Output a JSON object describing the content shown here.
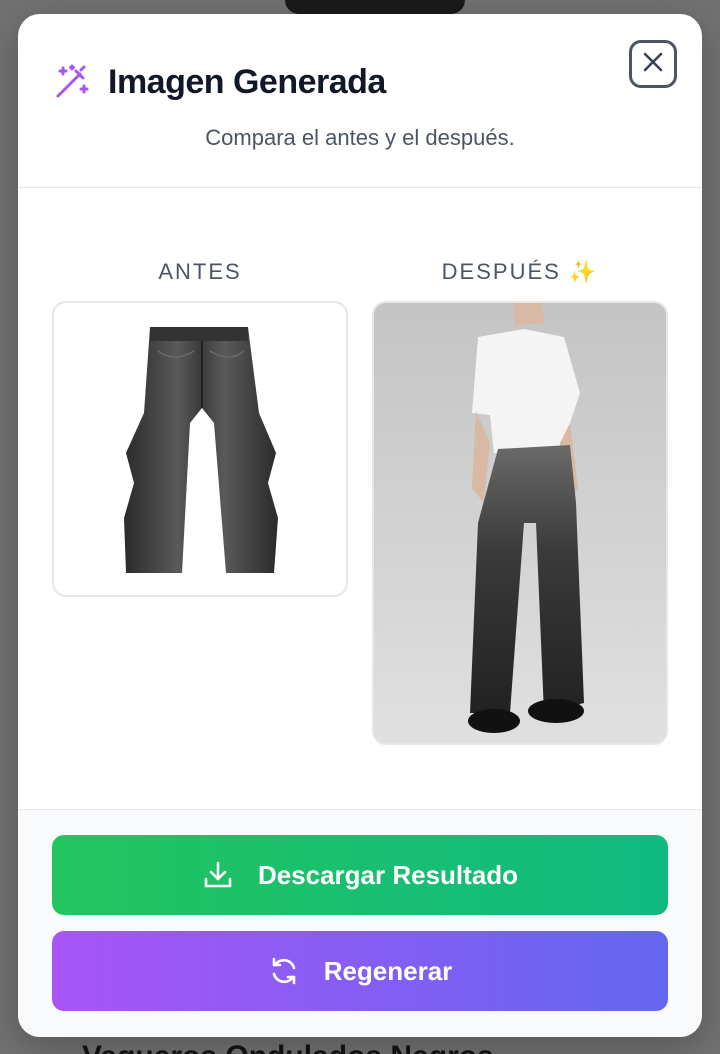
{
  "background": {
    "heading": "Vaqueros Ondulados Negros"
  },
  "modal": {
    "title": "Imagen Generada",
    "subtitle": "Compara el antes y el después.",
    "title_icon": "magic-wand-icon",
    "close_icon": "close-icon"
  },
  "compare": {
    "before_label": "ANTES",
    "after_label": "DESPUÉS ✨"
  },
  "actions": {
    "download_label": "Descargar Resultado",
    "download_icon": "download-icon",
    "regenerate_label": "Regenerar",
    "regenerate_icon": "refresh-icon"
  },
  "colors": {
    "accent_purple": "#a855f7",
    "download_green": "#22c55e",
    "regenerate_gradient_end": "#6366f1"
  }
}
